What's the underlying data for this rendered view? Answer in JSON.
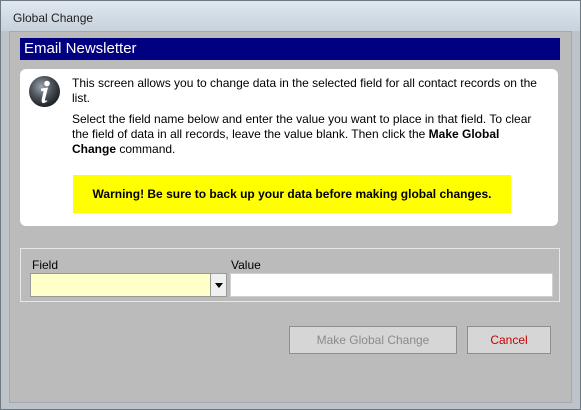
{
  "window": {
    "title": "Global Change"
  },
  "header": {
    "title": "Email Newsletter",
    "color": "#000080"
  },
  "info": {
    "icon": "info-icon",
    "paragraph1": "This screen allows you to change data in the selected field for all contact records on the list.",
    "paragraph2_pre": "Select the field name below and enter the value you want to place in that field.  To clear the field of data in all records, leave the value blank.  Then click the ",
    "paragraph2_bold": "Make Global Change",
    "paragraph2_post": " command.",
    "warning": "Warning! Be sure to back up your data before making global changes.",
    "warning_color": "#ffff00"
  },
  "form": {
    "field_label": "Field",
    "field_value": "",
    "value_label": "Value",
    "value_value": ""
  },
  "buttons": {
    "make_global_change": "Make Global Change",
    "cancel": "Cancel",
    "cancel_color": "#cc0000"
  }
}
